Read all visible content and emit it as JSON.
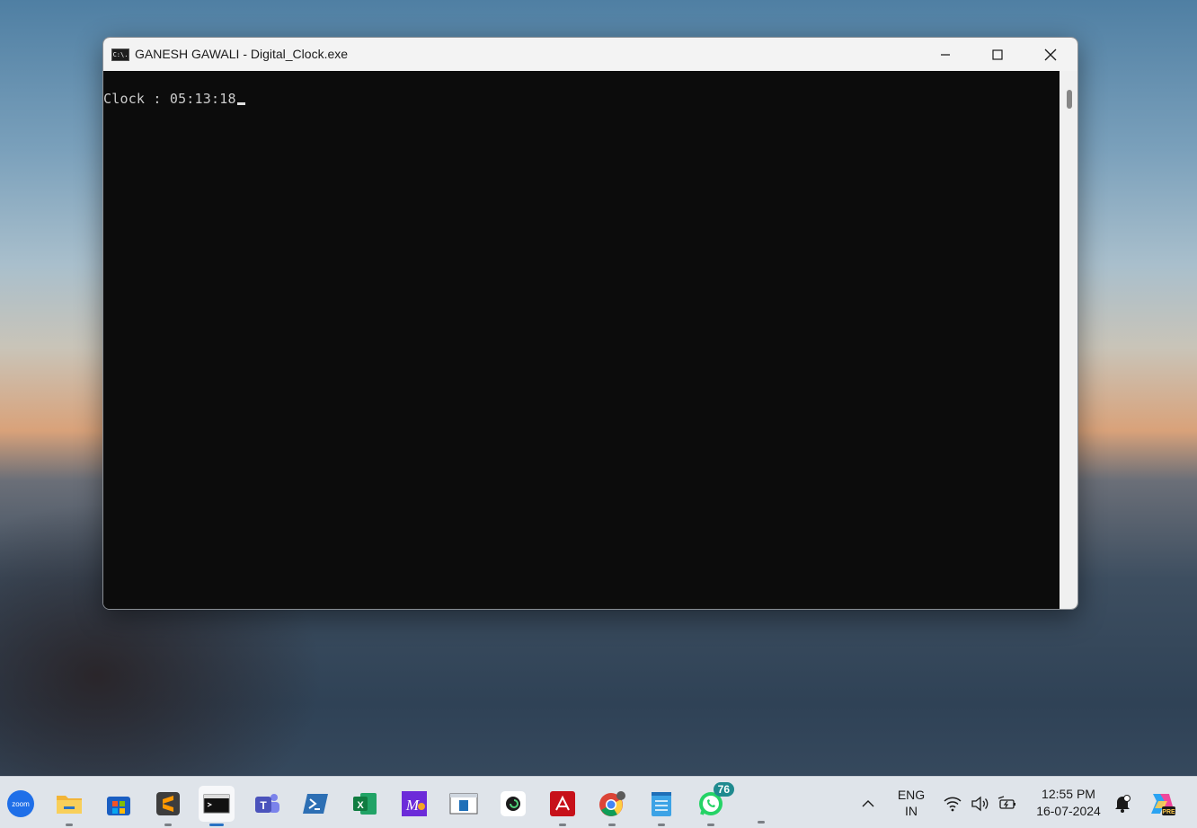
{
  "window": {
    "title": "GANESH GAWALI - Digital_Clock.exe",
    "icon_text": "C:\\.",
    "console_output": "Clock : 05:13:18"
  },
  "taskbar": {
    "apps": [
      {
        "name": "zoom",
        "label": "zoom"
      },
      {
        "name": "file-explorer"
      },
      {
        "name": "microsoft-store"
      },
      {
        "name": "sublime-text"
      },
      {
        "name": "terminal",
        "active": true
      },
      {
        "name": "teams"
      },
      {
        "name": "powershell"
      },
      {
        "name": "excel"
      },
      {
        "name": "m2-app"
      },
      {
        "name": "window-app"
      },
      {
        "name": "app-6"
      },
      {
        "name": "acrobat"
      },
      {
        "name": "chrome"
      },
      {
        "name": "notepad"
      },
      {
        "name": "whatsapp",
        "badge": "76"
      }
    ],
    "tray": {
      "language_line1": "ENG",
      "language_line2": "IN",
      "time": "12:55 PM",
      "date": "16-07-2024"
    }
  },
  "colors": {
    "console_bg": "#0c0c0c",
    "console_text": "#cccccc",
    "titlebar_bg": "#f3f3f3",
    "taskbar_bg": "#dfe4ea",
    "accent": "#2a72c4",
    "badge": "#1f8a8f"
  }
}
